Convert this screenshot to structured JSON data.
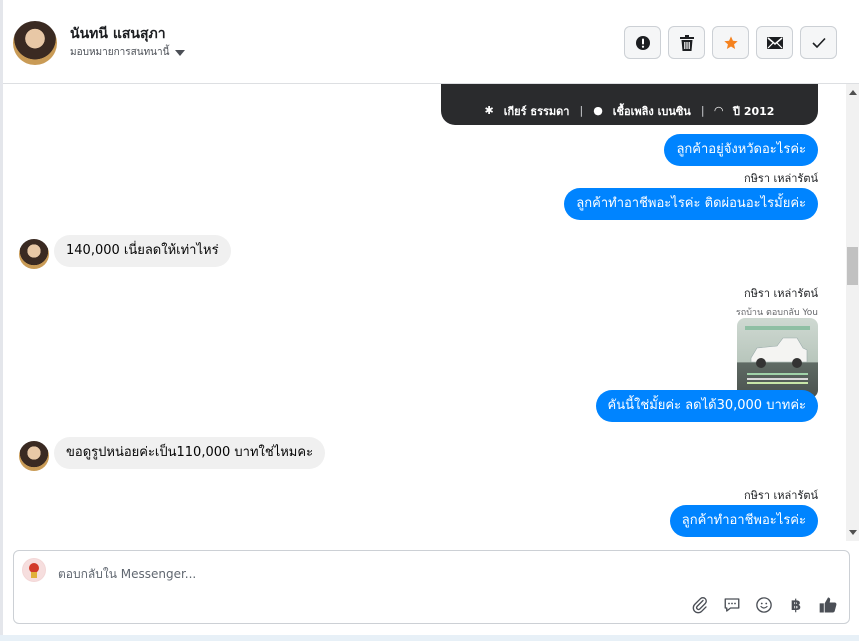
{
  "header": {
    "contact_name": "นันทนี แสนสุภา",
    "assign_label": "มอบหมายการสนทนานี้",
    "actions": [
      {
        "name": "spam-button",
        "icon": "alert-icon"
      },
      {
        "name": "delete-button",
        "icon": "trash-icon"
      },
      {
        "name": "star-button",
        "icon": "star-icon",
        "color": "#f5821f"
      },
      {
        "name": "mark-unread-button",
        "icon": "envelope-icon"
      },
      {
        "name": "mark-done-button",
        "icon": "check-icon"
      }
    ]
  },
  "thread": {
    "card": {
      "transmission": "เกียร์ ธรรมดา",
      "fuel": "เชื้อเพลิง เบนซิน",
      "year": "ปี 2012"
    },
    "messages": [
      {
        "direction": "out",
        "text": "ลูกค้าอยู่จังหวัดอะไรค่ะ"
      },
      {
        "direction": "out",
        "sender": "กษิรา เหล่ารัตน์",
        "text": "ลูกค้าทำอาชีพอะไรค่ะ ติดผ่อนอะไรมั้ยค่ะ"
      },
      {
        "direction": "in",
        "text": "140,000 เนี่ยลดให้เท่าไหร่"
      },
      {
        "direction": "out",
        "sender": "กษิรา เหล่ารัตน์",
        "reply_label": "รถบ้าน ตอบกลับ You",
        "text": "คันนี้ใช่มั้ยค่ะ ลดได้30,000 บาทค่ะ"
      },
      {
        "direction": "in",
        "text": "ขอดูรูปหน่อยค่ะเป็น110,000 บาทใช่ไหมคะ"
      },
      {
        "direction": "out",
        "sender": "กษิรา เหล่ารัตน์",
        "text": "ลูกค้าทำอาชีพอะไรค่ะ"
      }
    ]
  },
  "composer": {
    "placeholder": "ตอบกลับใน Messenger...",
    "tools": [
      "paperclip-icon",
      "saved-reply-icon",
      "emoji-icon",
      "baht-icon",
      "thumbs-up-icon"
    ],
    "baht_symbol": "฿"
  },
  "colors": {
    "outgoing_bubble": "#0084ff",
    "incoming_bubble": "#f0f0f0",
    "star": "#f5821f"
  }
}
